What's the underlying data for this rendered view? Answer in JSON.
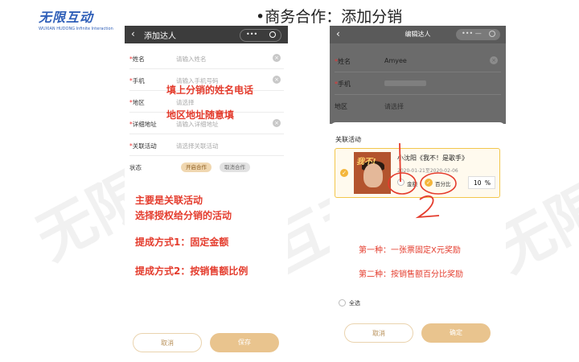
{
  "logo": {
    "text": "无限互动",
    "subtitle": "WUXIAN HUDONG Infinite Interaction"
  },
  "slide_title": "•商务合作：添加分销",
  "watermark": [
    "无限",
    "互动",
    "无限"
  ],
  "phone1": {
    "back_icon": "‹",
    "title": "添加达人",
    "capsule_dots": "•••",
    "rows": [
      {
        "label": "姓名",
        "required": "*",
        "placeholder": "请输入姓名"
      },
      {
        "label": "手机",
        "required": "*",
        "placeholder": "请输入手机号码"
      },
      {
        "label": "地区",
        "required": "*",
        "placeholder": "请选择"
      },
      {
        "label": "详细地址",
        "required": "*",
        "placeholder": "请输入详细地址"
      },
      {
        "label": "关联活动",
        "required": "*",
        "placeholder": "请选择关联活动"
      },
      {
        "label": "状态",
        "required": ""
      }
    ],
    "clear_icon": "×",
    "status_options": [
      "开启合作",
      "取消合作"
    ],
    "cancel_label": "取消",
    "save_label": "保存"
  },
  "notes_left": {
    "n1": "填上分销的姓名电话",
    "n2": "地区地址随意填",
    "n3": "主要是关联活动",
    "n4": "选择授权给分销的活动",
    "n5": "提成方式1：固定金额",
    "n6": "提成方式2：按销售额比例"
  },
  "phone2": {
    "back_icon": "‹",
    "title": "编辑达人",
    "capsule_icons": "••• —",
    "rows": [
      {
        "label": "姓名",
        "required": "*",
        "value": "Amyee"
      },
      {
        "label": "手机",
        "required": "*",
        "value": ""
      },
      {
        "label": "地区",
        "required": "",
        "value": "请选择"
      }
    ],
    "section_title": "关联活动",
    "event": {
      "album_text": "我不!",
      "title": "小沈阳《我不！是歌手》",
      "date": "2020-01-21至2020-02-06"
    },
    "option_fixed": "金额",
    "option_percent": "百分比",
    "percent_value": "10",
    "percent_unit": "%",
    "select_all": "全选",
    "cancel_label": "取消",
    "confirm_label": "确定"
  },
  "notes_right": {
    "n1": "第一种：一张票固定X元奖励",
    "n2": "第二种：按销售额百分比奖励"
  },
  "colors": {
    "accent": "#e9c48e",
    "note_red": "#e43c2d",
    "check_yellow": "#f4b63b"
  }
}
